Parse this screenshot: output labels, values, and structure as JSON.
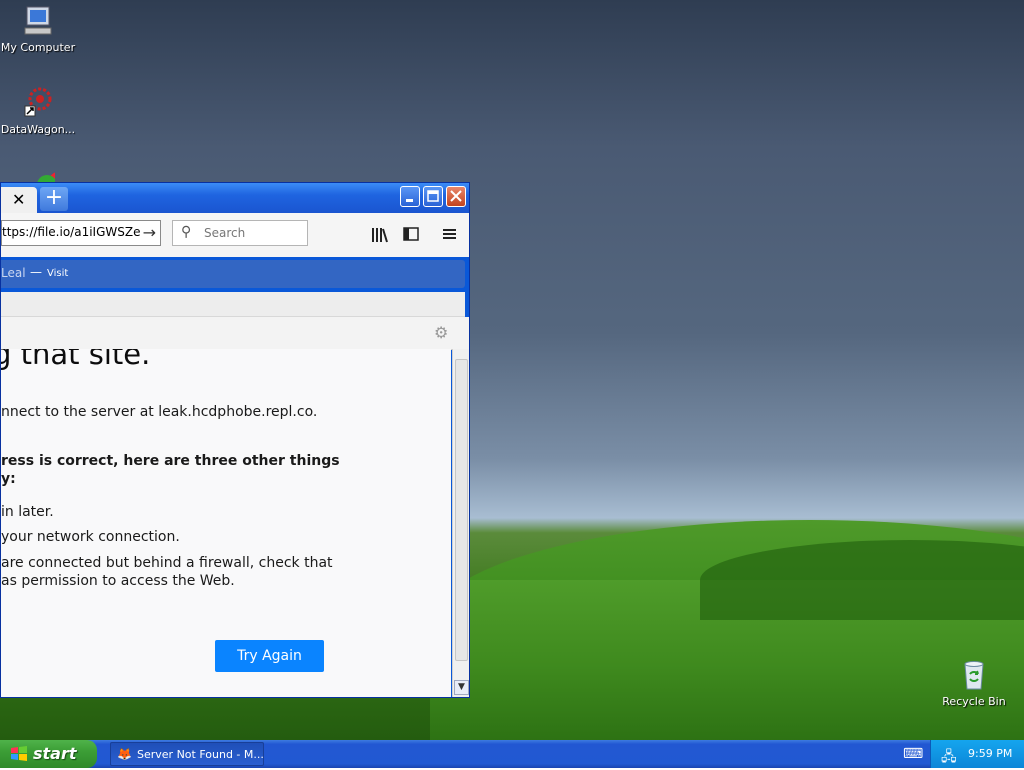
{
  "desktop": {
    "icons": [
      {
        "label": "My Computer",
        "icon": "my-computer-icon"
      },
      {
        "label": "DataWagon...",
        "icon": "datawagon-icon"
      },
      {
        "label": "",
        "icon": "app-icon"
      },
      {
        "label": "Recycle Bin",
        "icon": "recycle-bin-icon"
      }
    ]
  },
  "browser": {
    "tab_close": "✕",
    "new_tab": "+",
    "url": "ttps://file.io/a1iIGWSZe",
    "search_placeholder": "Search",
    "notification": {
      "prefix": "Leal",
      "dash": "—",
      "action": "Visit"
    },
    "error": {
      "title": "g that site.",
      "line1": "nnect to the server at leak.hcdphobe.repl.co.",
      "bold1": "ress is correct, here are three other things",
      "bold2": "y:",
      "item1": "in later.",
      "item2": "your network connection.",
      "item3a": "are connected but behind a firewall, check that",
      "item3b": "as permission to access the Web.",
      "try_again": "Try Again"
    }
  },
  "taskbar": {
    "start_label": "start",
    "task_label": "Server Not Found - M...",
    "clock": "9:59 PM"
  },
  "colors": {
    "accent": "#0a84ff",
    "notification_bg": "#3366c3",
    "taskbar": "#2257d2",
    "start": "#3c9e36"
  }
}
